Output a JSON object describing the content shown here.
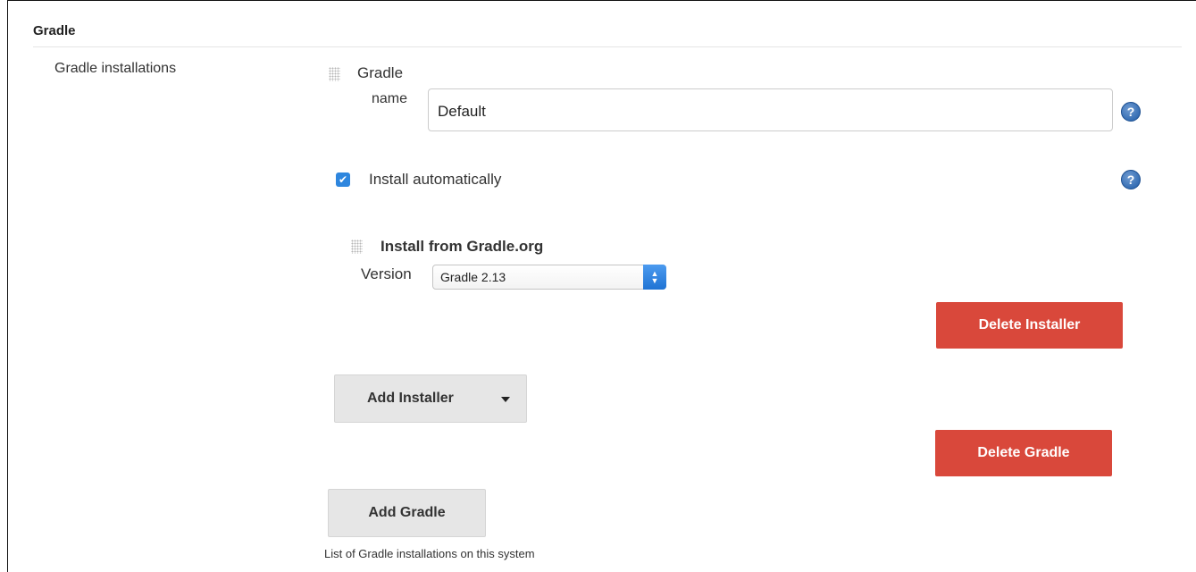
{
  "section": {
    "title": "Gradle"
  },
  "field": {
    "label": "Gradle installations"
  },
  "installation": {
    "header": "Gradle",
    "name_label": "name",
    "name_value": "Default",
    "help_glyph": "?",
    "install_auto_label": "Install automatically",
    "install_auto_checked": true
  },
  "installer": {
    "title": "Install from Gradle.org",
    "version_label": "Version",
    "version_value": "Gradle 2.13",
    "delete_label": "Delete Installer"
  },
  "buttons": {
    "add_installer": "Add Installer",
    "delete_gradle": "Delete Gradle",
    "add_gradle": "Add Gradle"
  },
  "hint": "List of Gradle installations on this system",
  "colors": {
    "danger": "#d9483b",
    "primary": "#2e86de",
    "neutral": "#e6e6e6"
  },
  "icons": [
    "drag-handle-icon",
    "help-icon",
    "checkmark-icon",
    "select-arrows-icon",
    "caret-down-icon"
  ]
}
